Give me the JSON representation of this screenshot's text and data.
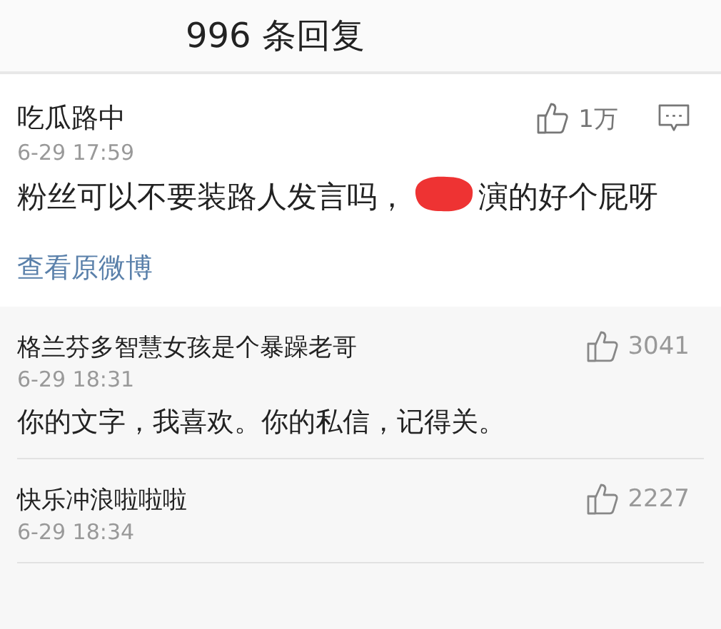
{
  "header": {
    "title": "996 条回复"
  },
  "comment": {
    "user": "吃瓜路中",
    "time": "6-29 17:59",
    "likes": "1万",
    "text_before": "粉丝可以不要装路人发言吗，",
    "redacted": true,
    "text_after": "演的好个屁呀",
    "link": "查看原微博"
  },
  "replies": [
    {
      "user": "格兰芬多智慧女孩是个暴躁老哥",
      "time": "6-29 18:31",
      "likes": "3041",
      "text": "你的文字，我喜欢。你的私信，记得关。"
    },
    {
      "user": "快乐冲浪啦啦啦",
      "time": "6-29 18:34",
      "likes": "2227"
    }
  ]
}
